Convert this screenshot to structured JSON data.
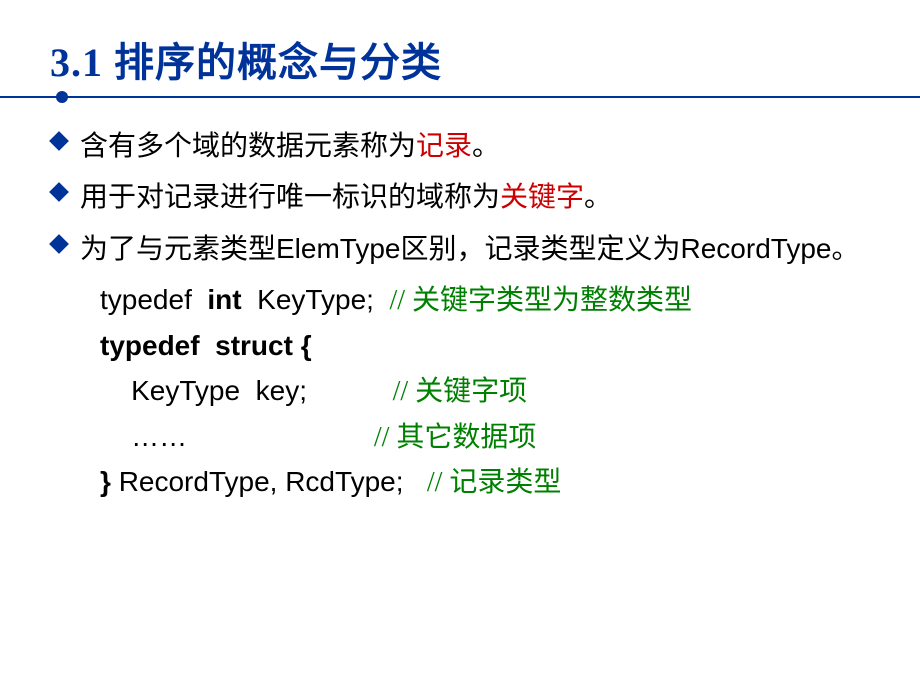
{
  "title": "3.1 排序的概念与分类",
  "bullets": [
    {
      "pre": "含有多个域的数据元素称为",
      "hl": "记录",
      "post": "。"
    },
    {
      "pre": "用于对记录进行唯一标识的域称为",
      "hl": "关键字",
      "post": "。"
    },
    {
      "pre": "为了与元素类型ElemType区别，记录类型定义为RecordType。",
      "hl": "",
      "post": ""
    }
  ],
  "code": {
    "l1a": "typedef  ",
    "l1b": "int",
    "l1c": "  KeyType;  ",
    "l1d": "// 关键字类型为整数类型",
    "l2": "typedef  struct {",
    "l3a": "    KeyType  key;           ",
    "l3b": "// 关键字项",
    "l4a": "    ……                        ",
    "l4b": "// 其它数据项",
    "l5a": "} ",
    "l5b": "RecordType, RcdType;   ",
    "l5c": "// 记录类型"
  }
}
